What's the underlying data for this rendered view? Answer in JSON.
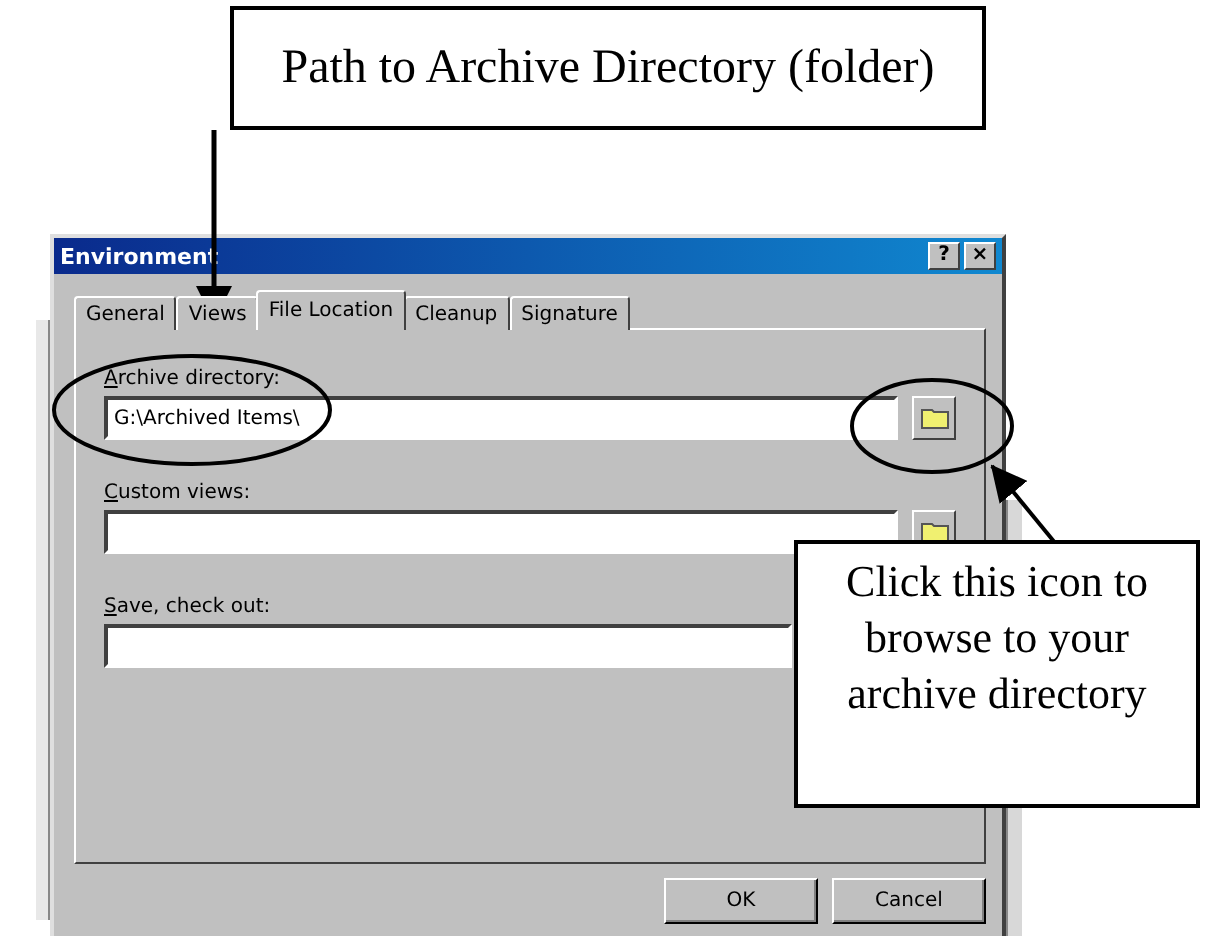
{
  "callouts": [
    {
      "text": "Path to Archive Directory (folder)"
    },
    {
      "text": "Click this icon to browse to your archive directory"
    }
  ],
  "window": {
    "title": "Environment",
    "title_buttons": [
      "?",
      "×"
    ]
  },
  "tabs": [
    {
      "label": "General",
      "selected": false
    },
    {
      "label": "Views",
      "selected": false
    },
    {
      "label": "File Location",
      "selected": true
    },
    {
      "label": "Cleanup",
      "selected": false
    },
    {
      "label": "Signature",
      "selected": false
    }
  ],
  "fields": [
    {
      "label": "Archive directory:",
      "value": "G:\\Archived Items\\",
      "browse_button": true
    },
    {
      "label": "Custom views:",
      "browse_button": true
    },
    {
      "label": "Save, check out:"
    }
  ],
  "buttons": [
    "OK",
    "Cancel"
  ]
}
